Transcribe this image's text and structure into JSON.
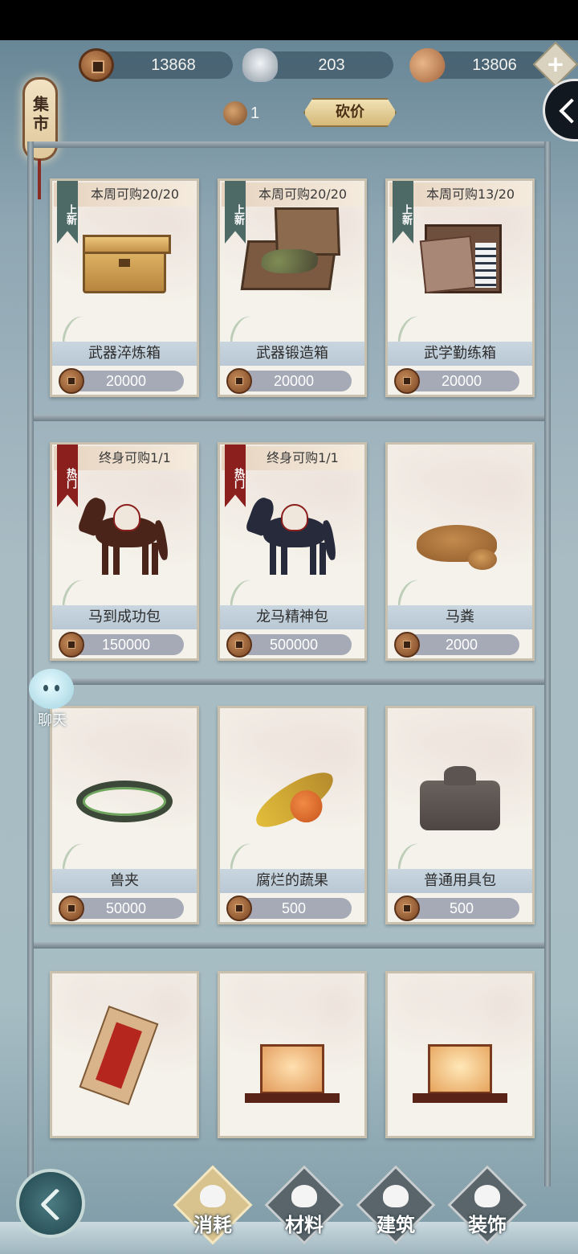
{
  "currencies": [
    {
      "name": "copper-coin",
      "value": "13868"
    },
    {
      "name": "silver-ingot",
      "value": "203"
    },
    {
      "name": "gold-bean",
      "value": "13806"
    }
  ],
  "market_sign": "集市",
  "bargain": {
    "count": "1",
    "button_label": "砍价"
  },
  "chat": {
    "label": "聊天"
  },
  "shelves": [
    [
      {
        "tag": "上新",
        "limit": "本周可购20/20",
        "name": "武器淬炼箱",
        "price": "20000",
        "icon": "wooden-chest"
      },
      {
        "tag": "上新",
        "limit": "本周可购20/20",
        "name": "武器锻造箱",
        "price": "20000",
        "icon": "open-weapon-box"
      },
      {
        "tag": "上新",
        "limit": "本周可购13/20",
        "name": "武学勤练箱",
        "price": "20000",
        "icon": "book-case"
      }
    ],
    [
      {
        "tag": "热门",
        "limit": "终身可购1/1",
        "name": "马到成功包",
        "price": "150000",
        "icon": "brown-horse"
      },
      {
        "tag": "热门",
        "limit": "终身可购1/1",
        "name": "龙马精神包",
        "price": "500000",
        "icon": "dark-horse"
      },
      {
        "tag": "",
        "limit": "",
        "name": "马粪",
        "price": "2000",
        "icon": "horse-dung"
      }
    ],
    [
      {
        "tag": "",
        "limit": "",
        "name": "兽夹",
        "price": "50000",
        "icon": "beast-trap"
      },
      {
        "tag": "",
        "limit": "",
        "name": "腐烂的蔬果",
        "price": "500",
        "icon": "rotten-fruit"
      },
      {
        "tag": "",
        "limit": "",
        "name": "普通用具包",
        "price": "500",
        "icon": "cloth-bundle"
      }
    ],
    [
      {
        "icon": "red-letter"
      },
      {
        "icon": "paper-lantern"
      },
      {
        "icon": "hexagon-lantern"
      }
    ]
  ],
  "nav": [
    {
      "label": "消耗",
      "active": true
    },
    {
      "label": "材料",
      "active": false
    },
    {
      "label": "建筑",
      "active": false
    },
    {
      "label": "装饰",
      "active": false
    }
  ],
  "colors": {
    "accent": "#d8c28d",
    "hot_tag": "#8a1f1d",
    "new_tag": "#4d6a66",
    "price_bar": "#a6a9b6"
  }
}
